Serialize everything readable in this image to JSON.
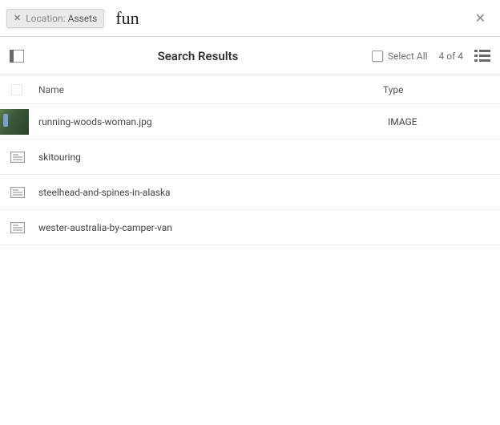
{
  "search": {
    "chip_label": "Location:",
    "chip_value": "Assets",
    "query": "fun"
  },
  "toolbar": {
    "title": "Search Results",
    "select_all": "Select All",
    "count": "4 of 4"
  },
  "columns": {
    "name": "Name",
    "type": "Type"
  },
  "results": [
    {
      "name": "running-woods-woman.jpg",
      "type": "IMAGE",
      "kind": "image"
    },
    {
      "name": "skitouring",
      "type": "",
      "kind": "page"
    },
    {
      "name": "steelhead-and-spines-in-alaska",
      "type": "",
      "kind": "page"
    },
    {
      "name": "wester-australia-by-camper-van",
      "type": "",
      "kind": "page"
    }
  ]
}
